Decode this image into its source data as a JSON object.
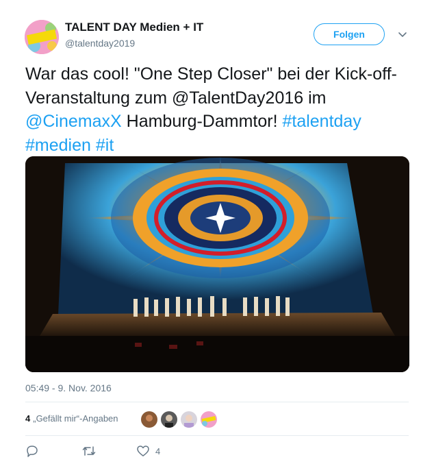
{
  "tweet": {
    "author_name": "TALENT DAY Medien + IT",
    "author_handle": "@talentday2019",
    "avatar_label": "TALENT DAY",
    "follow_label": "Folgen",
    "text_segments": [
      {
        "text": "War das cool! \"One Step Closer\" bei der Kick-off-Veranstaltung zum @TalentDay2016 im ",
        "link": false
      },
      {
        "text": "@CinemaxX",
        "link": true
      },
      {
        "text": " Hamburg-Dammtor! ",
        "link": false
      },
      {
        "text": "#talentday",
        "link": true
      },
      {
        "text": " ",
        "link": false
      },
      {
        "text": "#medien",
        "link": true
      },
      {
        "text": " ",
        "link": false
      },
      {
        "text": "#it",
        "link": true
      }
    ],
    "media_alt": "Tänzer auf der Kinobühne vor einer bunten Mandala-Projektion",
    "timestamp": "05:49 - 9. Nov. 2016",
    "likes_count": "4",
    "likes_label": "„Gefällt mir“-Angaben",
    "likers": [
      "liker-1",
      "liker-2",
      "liker-3",
      "liker-4"
    ],
    "actions": {
      "reply_count": "",
      "retweet_count": "",
      "like_count": "4"
    }
  },
  "colors": {
    "link": "#1da1f2",
    "secondary_text": "#657786",
    "separator": "#e6ecf0"
  },
  "icons": [
    "chevron-down-icon",
    "reply-icon",
    "retweet-icon",
    "heart-icon"
  ]
}
